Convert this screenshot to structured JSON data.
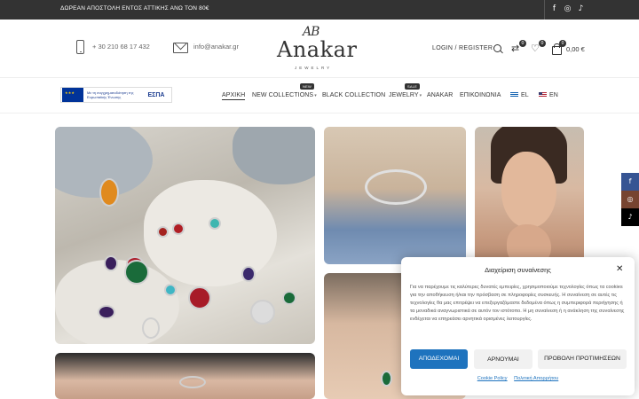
{
  "topbar": {
    "promo": "ΔΩΡΕΑΝ ΑΠΟΣΤΟΛΗ ΕΝΤΟΣ ΑΤΤΙΚΗΣ ΑΝΩ ΤΟΝ 80€",
    "social": [
      {
        "icon": "facebook-icon",
        "glyph": "f"
      },
      {
        "icon": "instagram-icon",
        "glyph": "◎"
      },
      {
        "icon": "tiktok-icon",
        "glyph": "♪"
      }
    ]
  },
  "header": {
    "phone": "+ 30 210 68 17 432",
    "email": "info@anakar.gr",
    "logo": {
      "mark": "ΑΒ",
      "name": "Anakar",
      "sub": "JEWELRY"
    },
    "login": "LOGIN / REGISTER",
    "compare_count": "0",
    "wishlist_count": "0",
    "cart_count": "0",
    "cart_total": "0,00 €"
  },
  "espa": {
    "text": "Με τη συγχρηματοδότηση της Ευρωπαϊκής Ένωσης",
    "logo": "ΕΣΠΑ"
  },
  "nav": {
    "items": [
      {
        "label": "ΑΡΧΙΚΗ"
      },
      {
        "label": "NEW COLLECTIONS",
        "badge": "NEW"
      },
      {
        "label": "BLACK COLLECTION"
      },
      {
        "label": "JEWELRY",
        "badge": "SALE"
      },
      {
        "label": "ANAKAR"
      },
      {
        "label": "ΕΠΙΚΟΙΝΩΝΙΑ"
      },
      {
        "label": "EL"
      },
      {
        "label": "EN"
      }
    ]
  },
  "side_social": {
    "facebook": "f",
    "instagram": "◎",
    "tiktok": "♪"
  },
  "cookie": {
    "title": "Διαχείριση συναίνεσης",
    "close": "✕",
    "body": "Για να παρέχουμε τις καλύτερες δυνατές εμπειρίες, χρησιμοποιούμε τεχνολογίες όπως τα cookies για την αποθήκευση ή/και την πρόσβαση σε πληροφορίες συσκευής. Η συναίνεση σε αυτές τις τεχνολογίες θα μας επιτρέψει να επεξεργαζόμαστε δεδομένα όπως η συμπεριφορά περιήγησης ή τα μοναδικά αναγνωριστικά σε αυτόν τον ιστότοπο. Η μη συναίνεση ή η ανάκληση της συναίνεσης ενδέχεται να επηρεάσει αρνητικά ορισμένες λειτουργίες.",
    "accept": "ΑΠΟΔΕΧΟΜΑΙ",
    "deny": "ΑΡΝΟΥΜΑΙ",
    "preferences": "ΠΡΟΒΟΛΗ ΠΡΟΤΙΜΗΣΕΩΝ",
    "cookie_policy": "Cookie Policy",
    "privacy_policy": "Πολιτική Απορρήτου"
  },
  "colors": {
    "topbar": "#333333",
    "accept_button": "#1e73be",
    "link": "#1e73be"
  }
}
